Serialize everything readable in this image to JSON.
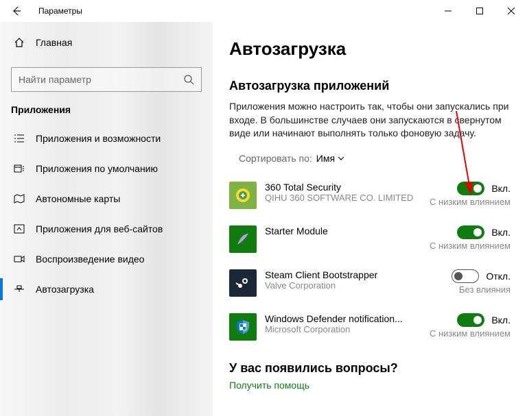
{
  "titlebar": {
    "title": "Параметры"
  },
  "sidebar": {
    "home": "Главная",
    "search_placeholder": "Найти параметр",
    "section": "Приложения",
    "items": [
      {
        "label": "Приложения и возможности"
      },
      {
        "label": "Приложения по умолчанию"
      },
      {
        "label": "Автономные карты"
      },
      {
        "label": "Приложения для веб-сайтов"
      },
      {
        "label": "Воспроизведение видео"
      },
      {
        "label": "Автозагрузка"
      }
    ]
  },
  "main": {
    "title": "Автозагрузка",
    "subtitle": "Автозагрузка приложений",
    "description": "Приложения можно настроить так, чтобы они запускались при входе. В большинстве случаев они запускаются в свернутом виде или начинают выполнять только фоновую задачу.",
    "sort_label": "Сортировать по:",
    "sort_value": "Имя",
    "toggle_on_label": "Вкл.",
    "toggle_off_label": "Откл.",
    "apps": [
      {
        "name": "360 Total Security",
        "publisher": "QIHU 360 SOFTWARE CO. LIMITED",
        "state": "on",
        "impact": "С низким влиянием",
        "icon_bg": "#7cb342"
      },
      {
        "name": "Starter Module",
        "publisher": "",
        "state": "on",
        "impact": "С низким влиянием",
        "icon_bg": "#107c10"
      },
      {
        "name": "Steam Client Bootstrapper",
        "publisher": "Valve Corporation",
        "state": "off",
        "impact": "Без влияния",
        "icon_bg": "#1b2838"
      },
      {
        "name": "Windows Defender notification...",
        "publisher": "Microsoft Corporation",
        "state": "on",
        "impact": "С низким влиянием",
        "icon_bg": "#107c10"
      }
    ],
    "questions": "У вас появились вопросы?",
    "help": "Получить помощь"
  }
}
